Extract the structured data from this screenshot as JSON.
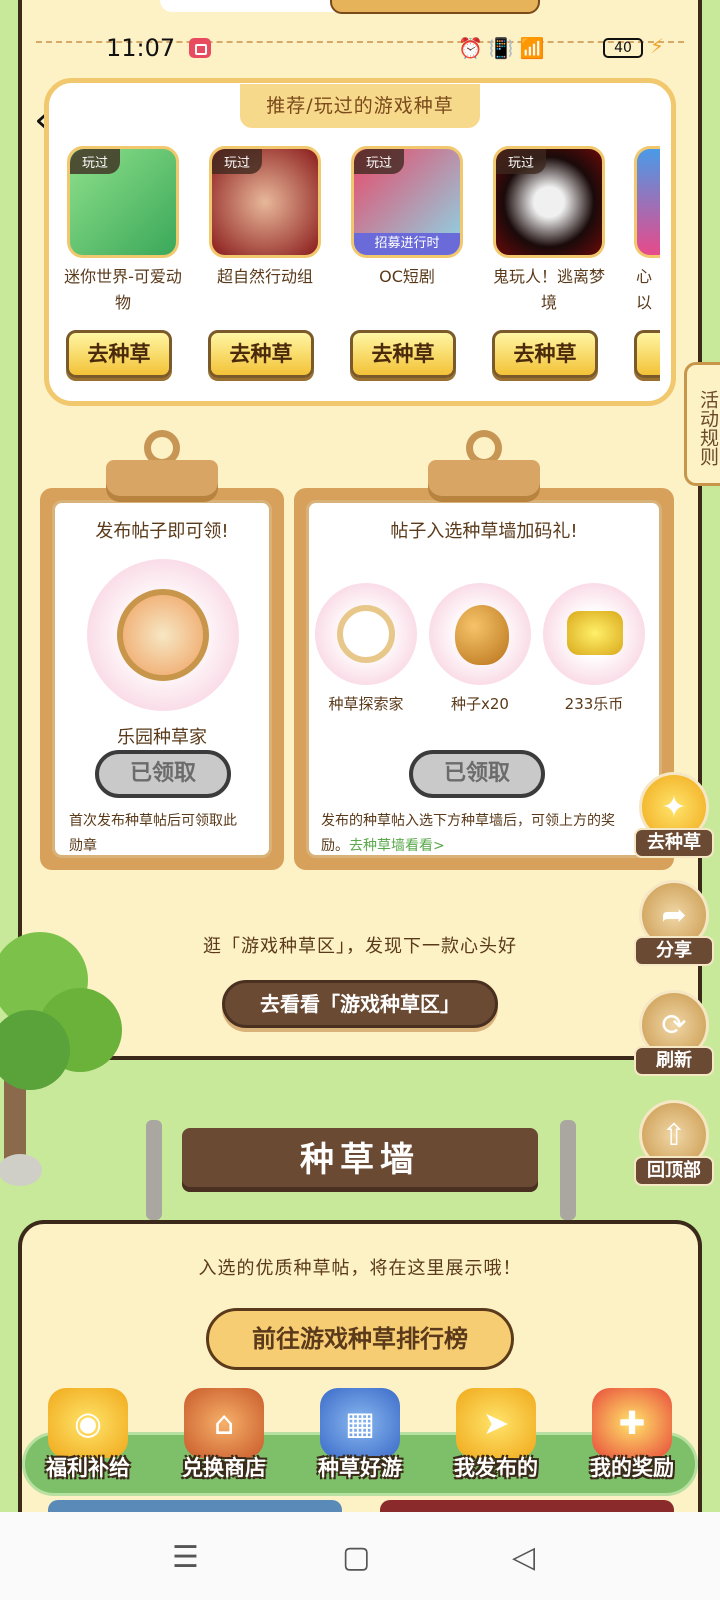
{
  "status": {
    "time": "11:07",
    "battery": "40"
  },
  "recommend": {
    "title": "推荐/玩过的游戏种草",
    "games": [
      {
        "badge": "玩过",
        "name": "迷你世界-可爱动物",
        "button": "去种草",
        "color": "#7cd27a"
      },
      {
        "badge": "玩过",
        "name": "超自然行动组",
        "button": "去种草",
        "color": "#b52a2a"
      },
      {
        "badge": "玩过",
        "name": "OC短剧",
        "button": "去种草",
        "color": "#7a86d8",
        "overlay": "招募进行时"
      },
      {
        "badge": "玩过",
        "name": "鬼玩人！逃离梦境",
        "button": "去种草",
        "color": "#2a1a1a"
      }
    ],
    "partial_name": "心\n以"
  },
  "rules_tab": "活动规则",
  "board_left": {
    "title": "发布帖子即可领!",
    "reward": "乐园种草家",
    "button": "已领取",
    "note": "首次发布种草帖后可领取此勋章"
  },
  "board_right": {
    "title": "帖子入选种草墙加码礼!",
    "rewards": [
      "种草探索家",
      "种子x20",
      "233乐币"
    ],
    "button": "已领取",
    "note_text": "发布的种草帖入选下方种草墙后，可领上方的奖励。",
    "note_link": "去种草墙看看>"
  },
  "explore_text": "逛「游戏种草区」，发现下一款心头好",
  "explore_button": "去看看「游戏种草区」",
  "float_buttons": [
    "去种草",
    "分享",
    "刷新",
    "回顶部"
  ],
  "wall": {
    "sign": "种草墙",
    "text": "入选的优质种草帖，将在这里展示哦！",
    "button": "前往游戏种草排行榜"
  },
  "nav": [
    "福利补给",
    "兑换商店",
    "种草好游",
    "我发布的",
    "我的奖励"
  ]
}
